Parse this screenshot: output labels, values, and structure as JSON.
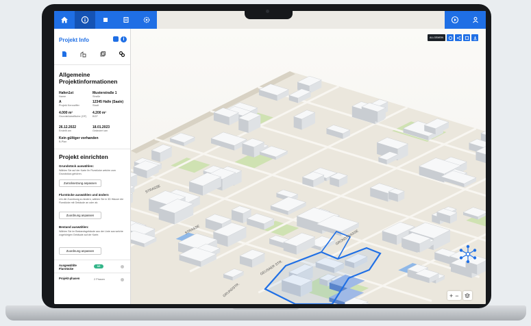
{
  "sidebar": {
    "title": "Projekt Info",
    "section_general": "Allgemeine Projektinformationen",
    "fields": [
      {
        "value": "Hafen1st",
        "label": "Name"
      },
      {
        "value": "Musterstraße 1",
        "label": "Straße"
      },
      {
        "value": "A",
        "label": "Projekt Kennziffer"
      },
      {
        "value": "12345 Halle (Saale)",
        "label": "Stadt"
      },
      {
        "value": "4.000 m²",
        "label": "Grundstücksfläche (GF)"
      },
      {
        "value": "4.200 m²",
        "label": "BGF"
      },
      {
        "value": "26.12.2022",
        "label": "Erstellt am"
      },
      {
        "value": "18.01.2023",
        "label": "Geändert am"
      }
    ],
    "plan_status": {
      "value": "Kein gültiger vorhanden",
      "label": "B-Plan"
    },
    "section_setup": "Projekt einrichten",
    "steps": [
      {
        "title": "Grundstück auswählen:",
        "text": "Wählen Sie auf der Karte Ihr Flurstücke welche zum Grundstück gehören.",
        "button": "Zurücksetzung anpassen"
      },
      {
        "title": "Flurstücke auswählen und ändern",
        "text": "Um die Zuordnung zu ändern, wählen Sie in 3D Häuser die Flurstücke mit Gebäude an oder ab.",
        "button": "Zuordnung anpassen"
      },
      {
        "title": "Bestand auswählen:",
        "text": "Wählen Sie im Bestandsgebäude aus der Liste aus welche zugehörigen Gebäude auf der Karte.",
        "button": "Zuordnung anpassen"
      }
    ],
    "selected_label": "Ausgewählte Flurstücke",
    "selected_badge": "3/3",
    "phase_label": "Projekt-phasen",
    "phase_value": "2 Phasen"
  },
  "map": {
    "tool_label": "ALLGEMEIN",
    "zoom_in": "+",
    "zoom_out": "−",
    "street_labels": [
      "STRASSE",
      "GRUNDSTR.",
      "GRÜNSTRASSE",
      "STRASSE",
      "GEUSAER STR."
    ]
  },
  "colors": {
    "accent": "#1f6fe5",
    "accent_dark": "#1553b4",
    "parcel_outline": "#1f6fe5"
  }
}
